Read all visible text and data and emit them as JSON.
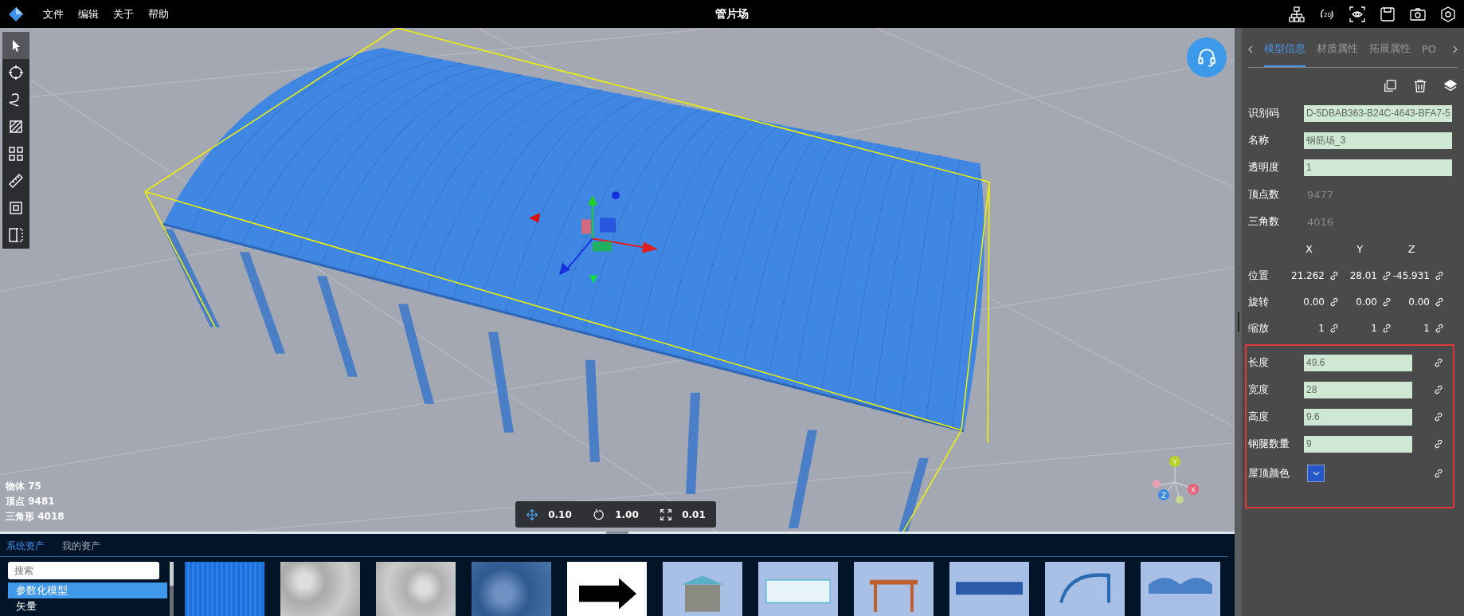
{
  "topbar": {
    "menu": [
      "文件",
      "编辑",
      "关于",
      "帮助"
    ],
    "title": "管片场",
    "mode_label": "2D"
  },
  "tools": [
    {
      "kind": "pointer",
      "selected": true
    },
    {
      "kind": "circle",
      "selected": false
    },
    {
      "kind": "curve",
      "selected": false
    },
    {
      "kind": "hatch",
      "selected": false
    },
    {
      "kind": "grid",
      "selected": false
    },
    {
      "kind": "ruler",
      "selected": false
    },
    {
      "kind": "area",
      "selected": false
    },
    {
      "kind": "split",
      "selected": false
    }
  ],
  "stats": [
    "物体 75",
    "顶点 9481",
    "三角形 4018"
  ],
  "transform_bar": [
    {
      "kind": "move",
      "value": "0.10"
    },
    {
      "kind": "rotate",
      "value": "1.00"
    },
    {
      "kind": "scale",
      "value": "0.01"
    }
  ],
  "axis_gizmo": {
    "x": "X",
    "y": "Y",
    "z": "Z"
  },
  "assets": {
    "tabs": [
      {
        "label": "系统资产",
        "selected": true
      },
      {
        "label": "我的资产",
        "selected": false
      }
    ],
    "search": {
      "placeholder": "搜索"
    },
    "categories": [
      {
        "label": "参数化模型",
        "selected": true
      },
      {
        "label": "矢量",
        "selected": false
      }
    ]
  },
  "panel": {
    "tabs": [
      {
        "label": "模型信息",
        "selected": true
      },
      {
        "label": "材质属性",
        "selected": false
      },
      {
        "label": "拓展属性",
        "selected": false
      },
      {
        "label": "PO",
        "selected": false
      }
    ],
    "fields": [
      {
        "label": "识别码",
        "kind": "input",
        "value": "D-5DBAB363-B24C-4643-BFA7-5"
      },
      {
        "label": "名称",
        "kind": "input",
        "value": "钢筋场_3"
      },
      {
        "label": "透明度",
        "kind": "input",
        "value": "1"
      },
      {
        "label": "顶点数",
        "kind": "text",
        "value": "9477"
      },
      {
        "label": "三角数",
        "kind": "text",
        "value": "4016"
      }
    ],
    "axes": [
      "X",
      "Y",
      "Z"
    ],
    "transforms": [
      {
        "label": "位置",
        "values": [
          "21.262",
          "28.01",
          "-45.931"
        ]
      },
      {
        "label": "旋转",
        "values": [
          "0.00",
          "0.00",
          "0.00"
        ]
      },
      {
        "label": "缩放",
        "values": [
          "1",
          "1",
          "1"
        ]
      }
    ],
    "parameters": [
      {
        "label": "长度",
        "kind": "input",
        "value": "49.6"
      },
      {
        "label": "宽度",
        "kind": "input",
        "value": "28"
      },
      {
        "label": "高度",
        "kind": "input",
        "value": "9.6"
      },
      {
        "label": "钢腿数量",
        "kind": "input",
        "value": "9"
      },
      {
        "label": "屋顶颜色",
        "kind": "color",
        "color": "#2456c8"
      }
    ]
  }
}
